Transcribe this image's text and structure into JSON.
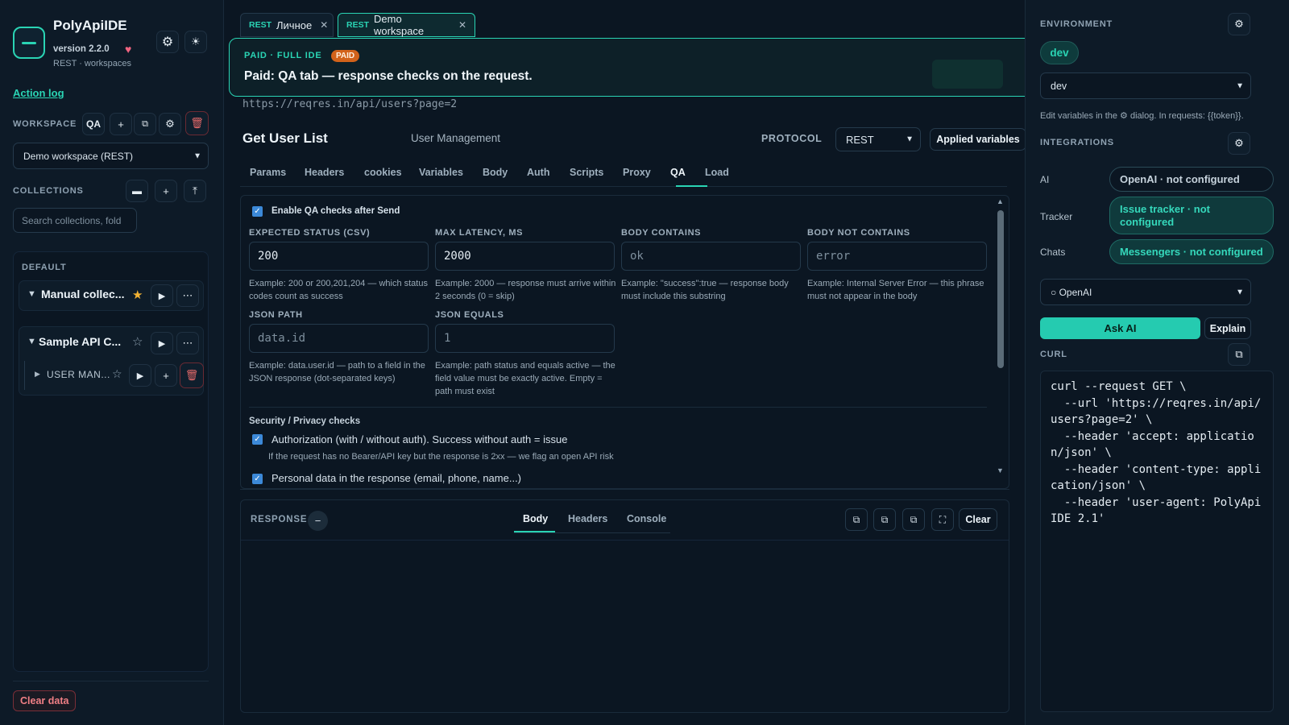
{
  "app": {
    "name": "PolyApiIDE",
    "version": "version 2.2.0",
    "subtitle": "REST · workspaces"
  },
  "sidebar": {
    "action_log": "Action log",
    "workspace_label": "WORKSPACE",
    "workspace_qa": "QA",
    "workspace_select": "Demo workspace (REST)",
    "collections_label": "COLLECTIONS",
    "search_placeholder": "Search collections, fold",
    "group_label": "DEFAULT",
    "collections": [
      {
        "name": "Manual collec...",
        "starred": true
      },
      {
        "name": "Sample API C...",
        "starred": false,
        "folder": "USER MAN..."
      }
    ],
    "clear_data": "Clear data"
  },
  "tabs": [
    {
      "proto": "REST",
      "label": "Личное"
    },
    {
      "proto": "REST",
      "label": "Demo workspace"
    }
  ],
  "banner": {
    "kicker": "PAID · FULL IDE",
    "badge": "PAID",
    "message": "Paid: QA tab — response checks on the request."
  },
  "request": {
    "url": "https://reqres.in/api/users?page=2",
    "name": "Get User List",
    "folder": "User Management",
    "protocol_label": "PROTOCOL",
    "protocol": "REST",
    "applied_variables": "Applied variables"
  },
  "subtabs": [
    "Params",
    "Headers",
    "cookies",
    "Variables",
    "Body",
    "Auth",
    "Scripts",
    "Proxy",
    "QA",
    "Load"
  ],
  "qa": {
    "enable_label": "Enable QA checks after Send",
    "expected_status_label": "EXPECTED STATUS (CSV)",
    "expected_status": "200",
    "expected_status_hint": "Example: 200 or 200,201,204 — which status codes count as success",
    "max_latency_label": "MAX LATENCY, MS",
    "max_latency": "2000",
    "max_latency_hint": "Example: 2000 — response must arrive within 2 seconds (0 = skip)",
    "body_contains_label": "BODY CONTAINS",
    "body_contains_placeholder": "ok",
    "body_contains_hint": "Example: \"success\":true — response body must include this substring",
    "body_not_contains_label": "BODY NOT CONTAINS",
    "body_not_contains_placeholder": "error",
    "body_not_contains_hint": "Example: Internal Server Error — this phrase must not appear in the body",
    "json_path_label": "JSON PATH",
    "json_path_placeholder": "data.id",
    "json_path_hint": "Example: data.user.id — path to a field in the JSON response (dot-separated keys)",
    "json_equals_label": "JSON EQUALS",
    "json_equals_placeholder": "1",
    "json_equals_hint": "Example: path status and equals active — the field value must be exactly active. Empty = path must exist",
    "security_title": "Security / Privacy checks",
    "auth_check_label": "Authorization (with / without auth). Success without auth = issue",
    "auth_check_hint": "If the request has no Bearer/API key but the response is 2xx — we flag an open API risk",
    "personal_data_label": "Personal data in the response (email, phone, name...)"
  },
  "response": {
    "label": "RESPONSE",
    "tabs": [
      "Body",
      "Headers",
      "Console"
    ],
    "clear": "Clear"
  },
  "right": {
    "environment_label": "ENVIRONMENT",
    "env_active": "dev",
    "env_select": "dev",
    "env_hint": "Edit variables in the ⚙ dialog. In requests: {{token}}.",
    "integrations_label": "INTEGRATIONS",
    "integrations": [
      {
        "label": "AI",
        "value": "OpenAI · not configured"
      },
      {
        "label": "Tracker",
        "value": "Issue tracker · not configured"
      },
      {
        "label": "Chats",
        "value": "Messengers · not configured"
      }
    ],
    "ai_select": "○ OpenAI",
    "ask_ai": "Ask AI",
    "explain": "Explain",
    "curl_label": "CURL",
    "curl": "curl --request GET \\\n  --url 'https://reqres.in/api/users?page=2' \\\n  --header 'accept: application/json' \\\n  --header 'content-type: application/json' \\\n  --header 'user-agent: PolyApiIDE 2.1'"
  },
  "colors": {
    "accent": "#2ad4b4",
    "background": "#0b1622",
    "danger": "#e66a6a",
    "badge": "#d2621a",
    "heart": "#f06480"
  }
}
